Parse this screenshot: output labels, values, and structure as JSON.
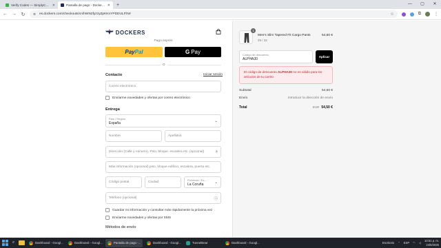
{
  "browser": {
    "tabs": [
      {
        "title": "Verify Codes — SimplyCodes",
        "active": false,
        "favicon_color": "#39b54a"
      },
      {
        "title": "Pantalla de pago - Dockers®",
        "active": true,
        "favicon_color": "#1d2c4d"
      }
    ],
    "new_tab": "+",
    "window_controls": [
      "—",
      "▢",
      "✕"
    ],
    "url": "es.dockers.com/checkouts/cn/hWN2fyzzyZpKKnYPDDULFhW"
  },
  "header": {
    "logo_text": "DOCKERS",
    "bag_icon": "shopping-bag-icon"
  },
  "express": {
    "label": "Pago exprés",
    "paypal_a": "Pay",
    "paypal_b": "Pal",
    "gpay": "Pay",
    "separator": "O"
  },
  "contact": {
    "heading": "Contacto",
    "login_link": "Iniciar sesión",
    "email_placeholder": "Correo electrónico",
    "newsletter_label": "Envíarme novedades y ofertas por correo electrónico"
  },
  "delivery": {
    "heading": "Entrega",
    "country_label": "País / Región",
    "country_value": "España",
    "first_name": "Nombre",
    "last_name": "Apellidos",
    "address": "Dirección (Calle y número), Piso, bloque, escalera etc. (opcional)",
    "address2": "Más información (opcional) piso, bloque edificio, escalera, puerta etc.",
    "postal_code": "Código postal",
    "city": "Ciudad",
    "province_label": "Provincia / Es...",
    "province_value": "La Coruña",
    "phone": "Teléfono (opcional)",
    "save_info_label": "Guardar mi información y consultar más rápidamente la próxima vez",
    "sms_label": "Envíarme novedades y ofertas por SMS",
    "shipping_heading": "Métodos de envío"
  },
  "summary": {
    "product_name": "Men's Slim Tapered Fit Cargo Pants",
    "product_variant": "29 / 32",
    "product_qty": "1",
    "product_price": "54,50 €",
    "discount_label": "Código de descuento",
    "discount_value": "ALPHA30",
    "apply_label": "Aplicar",
    "error_pre": "El código de descuento ",
    "error_code": "ALPHA30",
    "error_post": " no es válido para los artículos de tu carrito",
    "subtotal_label": "Subtotal",
    "subtotal_value": "54,50 €",
    "shipping_label": "Envío",
    "shipping_value": "Introducir la dirección de envío",
    "total_label": "Total",
    "total_currency": "EUR",
    "total_value": "54,50 €"
  },
  "taskbar": {
    "apps": [
      {
        "label": "Dashboard - Googl...",
        "active": false
      },
      {
        "label": "Dashboard - Googl...",
        "active": false
      },
      {
        "label": "Pantalla de pago -...",
        "active": true
      },
      {
        "label": "Dashboard - Googl...",
        "active": false
      },
      {
        "label": "TunnelBear",
        "active": false
      },
      {
        "label": "Dashboard - Googl...",
        "active": false
      }
    ],
    "tray_text": "Escritorio",
    "lang": "ESP",
    "time": "10:51 p. m.",
    "date": "24/6/2025"
  }
}
